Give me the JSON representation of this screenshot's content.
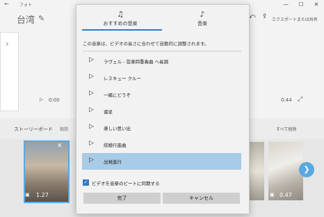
{
  "titlebar": {
    "app_name": "フォト",
    "back_icon": "←",
    "minimize": "—",
    "maximize": "☐",
    "close": "✕"
  },
  "header": {
    "project_title": "台湾",
    "edit_icon": "✎",
    "export_label": "エクスポートまたは共有",
    "icon_left": "⤺",
    "icon_share": "⇪"
  },
  "player": {
    "play_icon": "▷",
    "time_start": "0:00",
    "time_end": "0:44",
    "fullscreen_icon": "⤢",
    "preview_chevron": "›"
  },
  "storyboard": {
    "title": "ストーリーボード",
    "subtitle": "期間",
    "remove_all": "すべて削除",
    "thumb1_duration": "1.27",
    "thumb2_duration": "0.47",
    "image_icon": "▣",
    "close_icon": "✕",
    "next_icon": "❯"
  },
  "dialog": {
    "tabs": [
      {
        "label": "おすすめの音楽",
        "icon": "♫"
      },
      {
        "label": "音楽",
        "icon": "♪"
      }
    ],
    "description": "この音楽は、ビデオの長さに合わせて自動的に調整されます。",
    "tracks": [
      {
        "label": "ラヴェル - 弦楽四重奏曲 ヘ長調"
      },
      {
        "label": "レスキュー クルー"
      },
      {
        "label": "一緒にどうぞ"
      },
      {
        "label": "遠足"
      },
      {
        "label": "楽しい思い出"
      },
      {
        "label": "結婚行進曲"
      },
      {
        "label": "出発進行"
      }
    ],
    "selected_track": "出発進行",
    "play_icon": "▷",
    "sync_label": "ビデオを音楽のビートに同期する",
    "sync_checked": "✓",
    "ok_label": "完了",
    "cancel_label": "キャンセル"
  },
  "colors": {
    "accent": "#3178c6",
    "selected_row": "#a8cbe7"
  }
}
